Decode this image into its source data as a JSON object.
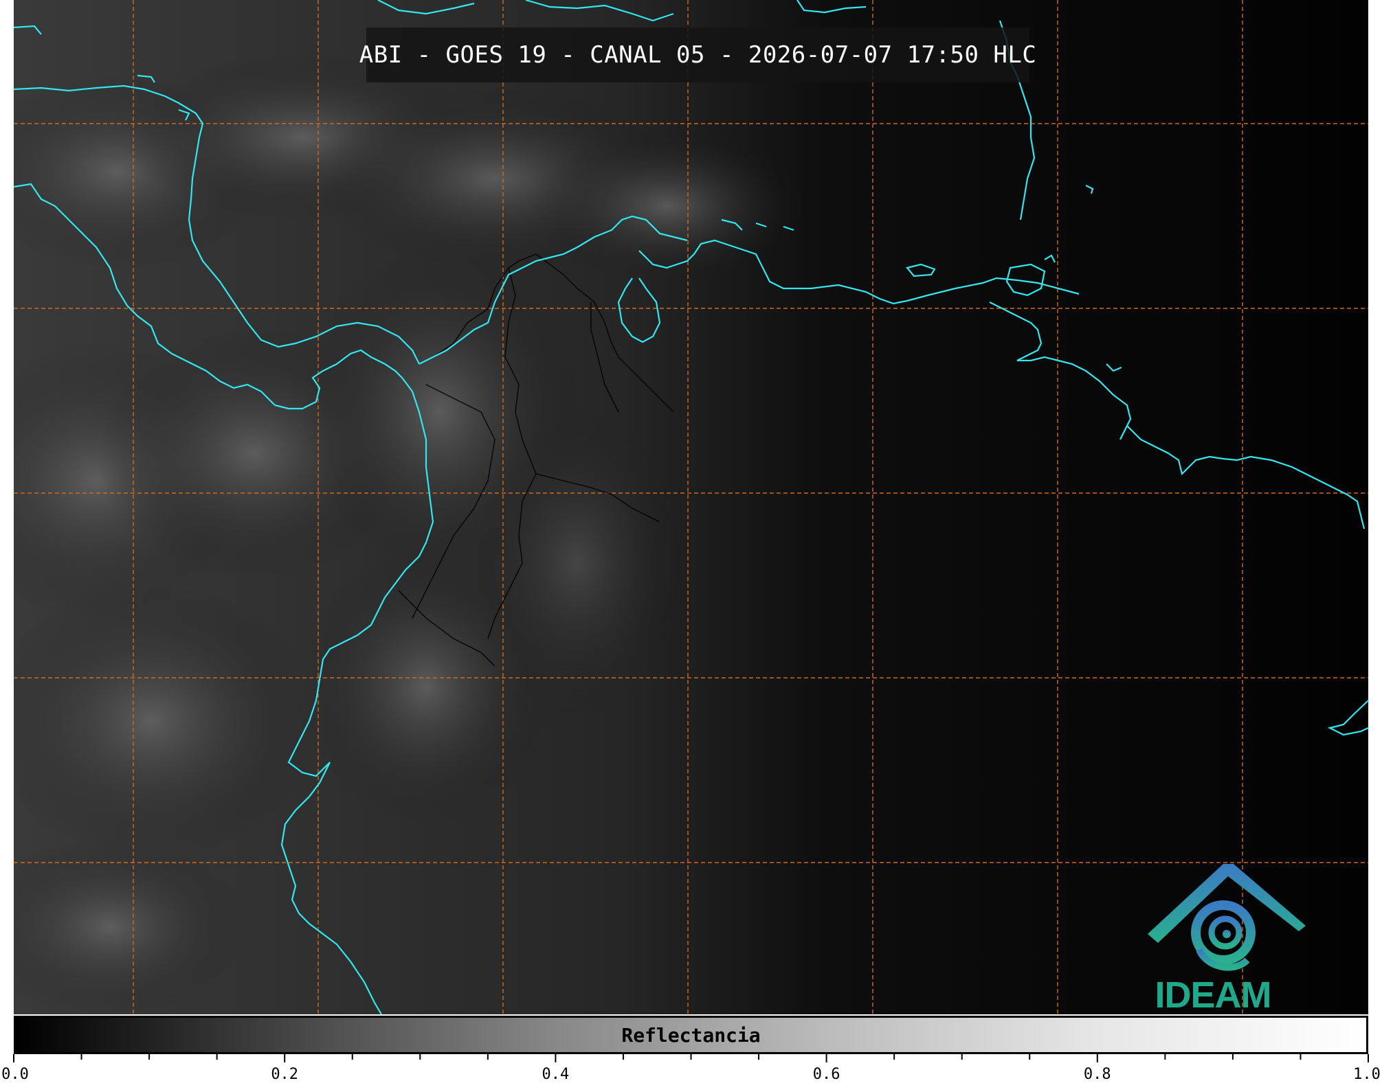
{
  "title": "ABI - GOES 19 - CANAL 05 - 2026-07-07 17:50 HLC",
  "colorbar": {
    "label": "Reflectancia",
    "range": [
      0.0,
      1.0
    ],
    "major_ticks": [
      "0.0",
      "0.2",
      "0.4",
      "0.6",
      "0.8",
      "1.0"
    ],
    "minor_tick_step": 0.05,
    "colormap": "grayscale black-to-white"
  },
  "logo": {
    "text": "IDEAM",
    "color": "#1fa98a"
  },
  "colors": {
    "coastline": "#33e6f0",
    "gridlines": "#d2691e",
    "background": "#050505",
    "borders": "#000000"
  },
  "map": {
    "gridlines_style": "dashed",
    "coastlines": true,
    "country_borders": true
  }
}
